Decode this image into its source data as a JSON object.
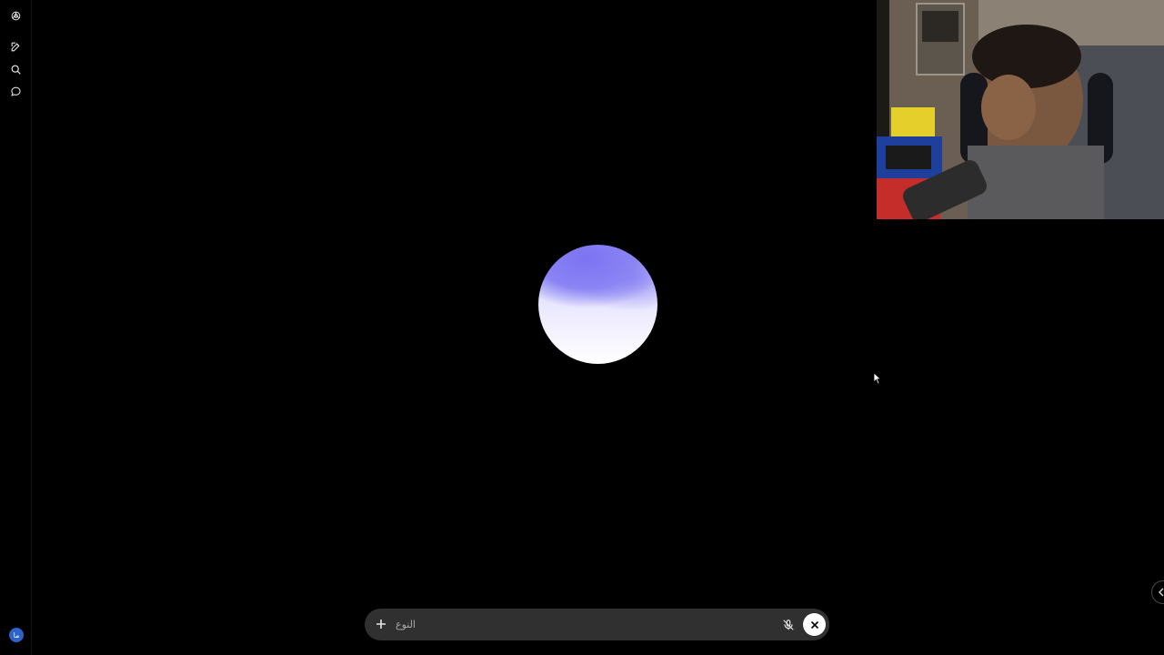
{
  "sidebar": {
    "items": [
      {
        "icon": "chatgpt-logo-icon"
      },
      {
        "icon": "new-chat-icon"
      },
      {
        "icon": "search-icon"
      },
      {
        "icon": "chat-bubble-icon"
      }
    ],
    "avatar_initials": "ما",
    "avatar_color": "#2b63c9"
  },
  "voice_mode": {
    "orb_colors": [
      "#7c73f2",
      "#eceafe",
      "#ffffff"
    ]
  },
  "composer": {
    "placeholder": "النوع",
    "plus_icon": "plus-icon",
    "mic_icon": "mic-off-icon",
    "close_icon": "close-icon"
  },
  "colors": {
    "background": "#000000",
    "composer_bg": "#303030"
  }
}
